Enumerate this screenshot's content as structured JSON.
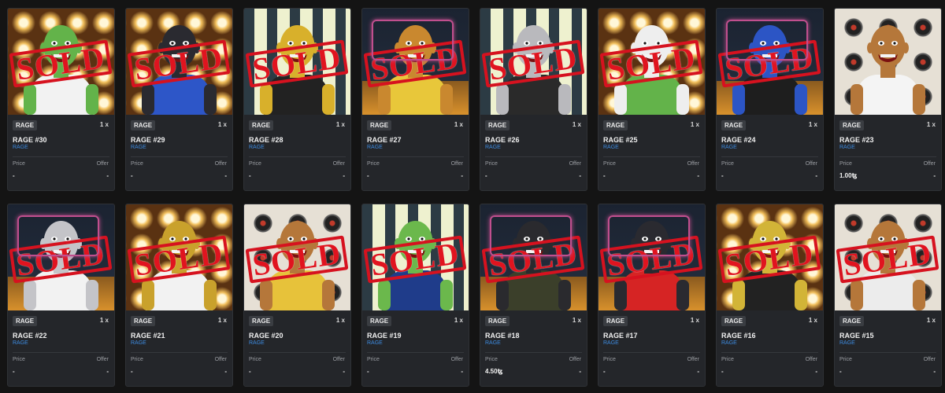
{
  "sold_label": "SOLD",
  "labels": {
    "price": "Price",
    "offer": "Offer"
  },
  "cards": [
    {
      "tag": "RAGE",
      "qty": "1 x",
      "title": "RAGE #30",
      "collection": "RAGE",
      "price": "-",
      "offer": "-",
      "bg": "lights",
      "skin": "#63b34a",
      "shirt": "#f2f2f2",
      "sold": true
    },
    {
      "tag": "RAGE",
      "qty": "1 x",
      "title": "RAGE #29",
      "collection": "RAGE",
      "price": "-",
      "offer": "-",
      "bg": "lights",
      "skin": "#2a2a30",
      "shirt": "#2d56c8",
      "sold": true
    },
    {
      "tag": "RAGE",
      "qty": "1 x",
      "title": "RAGE #28",
      "collection": "RAGE",
      "price": "-",
      "offer": "-",
      "bg": "stripes",
      "skin": "#d8b02b",
      "shirt": "#222222",
      "sold": true
    },
    {
      "tag": "RAGE",
      "qty": "1 x",
      "title": "RAGE #27",
      "collection": "RAGE",
      "price": "-",
      "offer": "-",
      "bg": "neon",
      "skin": "#c9882f",
      "shirt": "#e8c73a",
      "sold": true
    },
    {
      "tag": "RAGE",
      "qty": "1 x",
      "title": "RAGE #26",
      "collection": "RAGE",
      "price": "-",
      "offer": "-",
      "bg": "stripes",
      "skin": "#b9b9bd",
      "shirt": "#2a2a2a",
      "sold": true
    },
    {
      "tag": "RAGE",
      "qty": "1 x",
      "title": "RAGE #25",
      "collection": "RAGE",
      "price": "-",
      "offer": "-",
      "bg": "lights",
      "skin": "#eeeeee",
      "shirt": "#63b34a",
      "sold": true
    },
    {
      "tag": "RAGE",
      "qty": "1 x",
      "title": "RAGE #24",
      "collection": "RAGE",
      "price": "-",
      "offer": "-",
      "bg": "neon",
      "skin": "#2c55c5",
      "shirt": "#1e1e1e",
      "sold": true
    },
    {
      "tag": "RAGE",
      "qty": "1 x",
      "title": "RAGE #23",
      "collection": "RAGE",
      "price": "1.00ꜩ",
      "offer": "-",
      "bg": "speaker",
      "skin": "#b5773a",
      "shirt": "#f4f4f4",
      "sold": false
    },
    {
      "tag": "RAGE",
      "qty": "1 x",
      "title": "RAGE #22",
      "collection": "RAGE",
      "price": "-",
      "offer": "-",
      "bg": "neon",
      "skin": "#c4c4c8",
      "shirt": "#f2f2f2",
      "sold": true
    },
    {
      "tag": "RAGE",
      "qty": "1 x",
      "title": "RAGE #21",
      "collection": "RAGE",
      "price": "-",
      "offer": "-",
      "bg": "lights",
      "skin": "#c9a12c",
      "shirt": "#f2f2f2",
      "sold": true
    },
    {
      "tag": "RAGE",
      "qty": "1 x",
      "title": "RAGE #20",
      "collection": "RAGE",
      "price": "-",
      "offer": "-",
      "bg": "speaker",
      "skin": "#b5773a",
      "shirt": "#e7c23a",
      "sold": true
    },
    {
      "tag": "RAGE",
      "qty": "1 x",
      "title": "RAGE #19",
      "collection": "RAGE",
      "price": "-",
      "offer": "-",
      "bg": "stripes",
      "skin": "#6bb84c",
      "shirt": "#1f3c8a",
      "sold": true
    },
    {
      "tag": "RAGE",
      "qty": "1 x",
      "title": "RAGE #18",
      "collection": "RAGE",
      "price": "4.50ꜩ",
      "offer": "-",
      "bg": "neon",
      "skin": "#2a2a2e",
      "shirt": "#3b3f2a",
      "sold": true
    },
    {
      "tag": "RAGE",
      "qty": "1 x",
      "title": "RAGE #17",
      "collection": "RAGE",
      "price": "-",
      "offer": "-",
      "bg": "neon",
      "skin": "#2a2a30",
      "shirt": "#d62424",
      "sold": true
    },
    {
      "tag": "RAGE",
      "qty": "1 x",
      "title": "RAGE #16",
      "collection": "RAGE",
      "price": "-",
      "offer": "-",
      "bg": "lights",
      "skin": "#d2b437",
      "shirt": "#222222",
      "sold": true
    },
    {
      "tag": "RAGE",
      "qty": "1 x",
      "title": "RAGE #15",
      "collection": "RAGE",
      "price": "-",
      "offer": "-",
      "bg": "speaker",
      "skin": "#b5773a",
      "shirt": "#ececec",
      "sold": true
    }
  ]
}
